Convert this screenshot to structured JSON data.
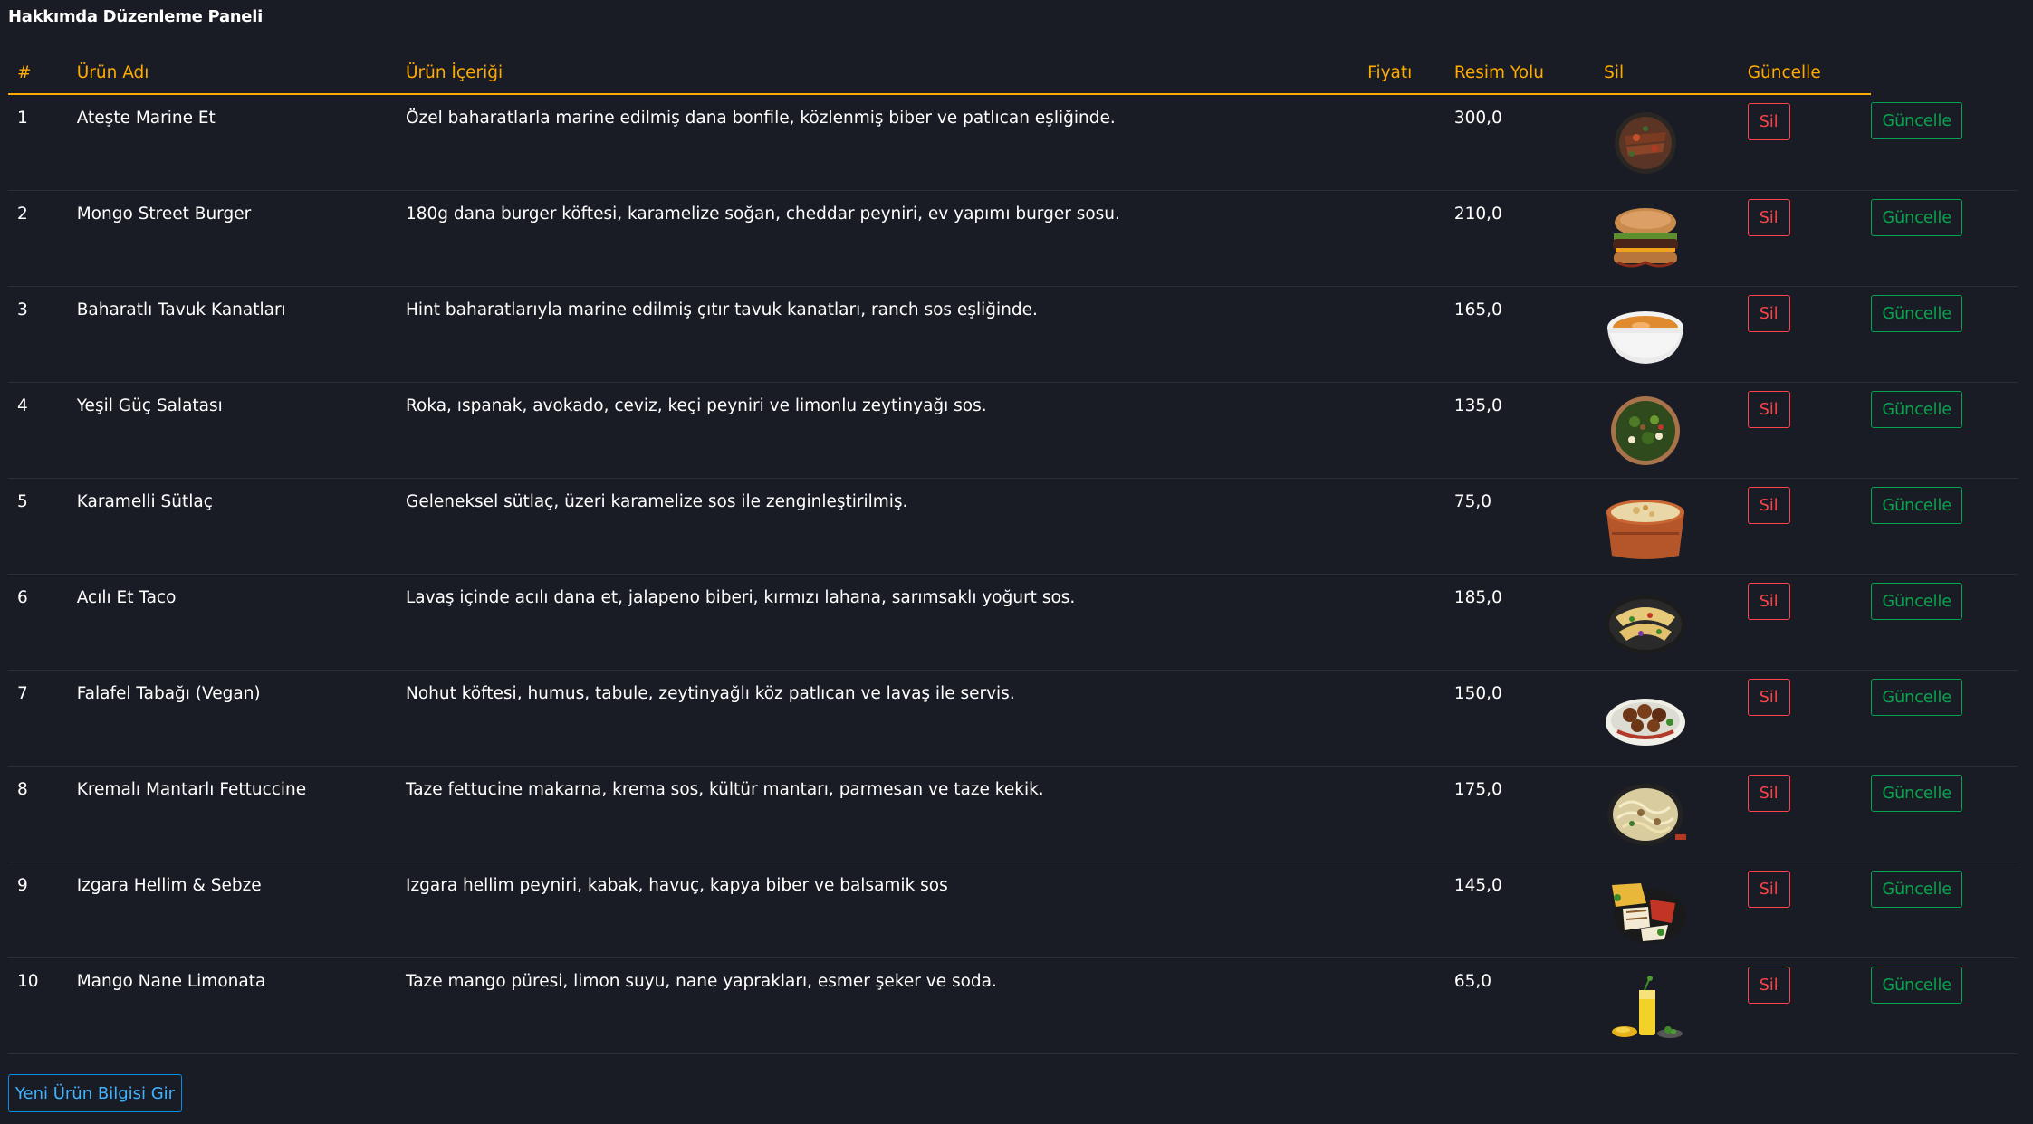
{
  "page": {
    "title": "Hakkımda Düzenleme Paneli"
  },
  "table": {
    "headers": {
      "num": "#",
      "name": "Ürün Adı",
      "desc": "Ürün İçeriği",
      "price": "Fiyatı",
      "path": "Resim Yolu",
      "del": "Sil",
      "upd": "Güncelle"
    },
    "rows": [
      {
        "num": "1",
        "name": "Ateşte Marine Et",
        "desc": "Özel baharatlarla marine edilmiş dana bonfile, közlenmiş biber ve patlıcan eşliğinde.",
        "path": "300,0",
        "image_icon": "grilled-meat-image",
        "del": "Sil",
        "upd": "Güncelle"
      },
      {
        "num": "2",
        "name": "Mongo Street Burger",
        "desc": "180g dana burger köftesi, karamelize soğan, cheddar peyniri, ev yapımı burger sosu.",
        "path": "210,0",
        "image_icon": "burger-image",
        "del": "Sil",
        "upd": "Güncelle"
      },
      {
        "num": "3",
        "name": "Baharatlı Tavuk Kanatları",
        "desc": "Hint baharatlarıyla marine edilmiş çıtır tavuk kanatları, ranch sos eşliğinde.",
        "path": "165,0",
        "image_icon": "soup-bowl-image",
        "del": "Sil",
        "upd": "Güncelle"
      },
      {
        "num": "4",
        "name": "Yeşil Güç Salatası",
        "desc": "Roka, ıspanak, avokado, ceviz, keçi peyniri ve limonlu zeytinyağı sos.",
        "path": "135,0",
        "image_icon": "salad-image",
        "del": "Sil",
        "upd": "Güncelle"
      },
      {
        "num": "5",
        "name": "Karamelli Sütlaç",
        "desc": "Geleneksel sütlaç, üzeri karamelize sos ile zenginleştirilmiş.",
        "path": "75,0",
        "image_icon": "rice-pudding-image",
        "del": "Sil",
        "upd": "Güncelle"
      },
      {
        "num": "6",
        "name": "Acılı Et Taco",
        "desc": "Lavaş içinde acılı dana et, jalapeno biberi, kırmızı lahana, sarımsaklı yoğurt sos.",
        "path": "185,0",
        "image_icon": "taco-plate-image",
        "del": "Sil",
        "upd": "Güncelle"
      },
      {
        "num": "7",
        "name": "Falafel Tabağı (Vegan)",
        "desc": "Nohut köftesi, humus, tabule, zeytinyağlı köz patlıcan ve lavaş ile servis.",
        "path": "150,0",
        "image_icon": "falafel-plate-image",
        "del": "Sil",
        "upd": "Güncelle"
      },
      {
        "num": "8",
        "name": "Kremalı Mantarlı Fettuccine",
        "desc": "Taze fettucine makarna, krema sos, kültür mantarı, parmesan ve taze kekik.",
        "path": "175,0",
        "image_icon": "pasta-pan-image",
        "del": "Sil",
        "upd": "Güncelle"
      },
      {
        "num": "9",
        "name": "Izgara Hellim & Sebze",
        "desc": "Izgara hellim peyniri, kabak, havuç, kapya biber ve balsamik sos",
        "path": "145,0",
        "image_icon": "grilled-halloumi-image",
        "del": "Sil",
        "upd": "Güncelle"
      },
      {
        "num": "10",
        "name": "Mango Nane Limonata",
        "desc": "Taze mango püresi, limon suyu, nane yaprakları, esmer şeker ve soda.",
        "path": "65,0",
        "image_icon": "lemonade-drink-image",
        "del": "Sil",
        "upd": "Güncelle"
      }
    ]
  },
  "footer": {
    "new_button": "Yeni Ürün Bilgisi Gir"
  },
  "colors": {
    "background": "#191c24",
    "header_accent": "#ffab00",
    "delete": "#fc424a",
    "update": "#00d25b",
    "primary": "#0090e7"
  }
}
